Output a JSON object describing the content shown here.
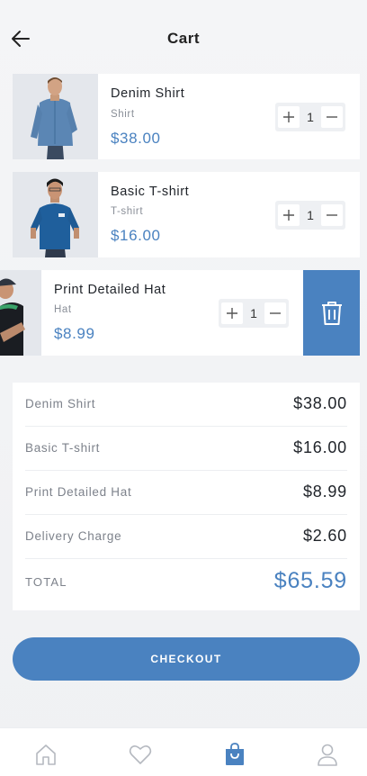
{
  "header": {
    "title": "Cart"
  },
  "items": [
    {
      "name": "Denim Shirt",
      "category": "Shirt",
      "price": "$38.00",
      "qty": "1"
    },
    {
      "name": "Basic T-shirt",
      "category": "T-shirt",
      "price": "$16.00",
      "qty": "1"
    },
    {
      "name": "Print Detailed Hat",
      "category": "Hat",
      "price": "$8.99",
      "qty": "1"
    }
  ],
  "summary": {
    "rows": [
      {
        "label": "Denim Shirt",
        "value": "$38.00"
      },
      {
        "label": "Basic T-shirt",
        "value": "$16.00"
      },
      {
        "label": "Print Detailed Hat",
        "value": "$8.99"
      },
      {
        "label": "Delivery Charge",
        "value": "$2.60"
      }
    ],
    "total_label": "TOTAL",
    "total_value": "$65.59"
  },
  "checkout_label": "CHECKOUT",
  "colors": {
    "accent": "#4a82c0",
    "background": "#f2f3f5"
  },
  "nav": [
    "home-icon",
    "heart-icon",
    "bag-icon",
    "user-icon"
  ]
}
